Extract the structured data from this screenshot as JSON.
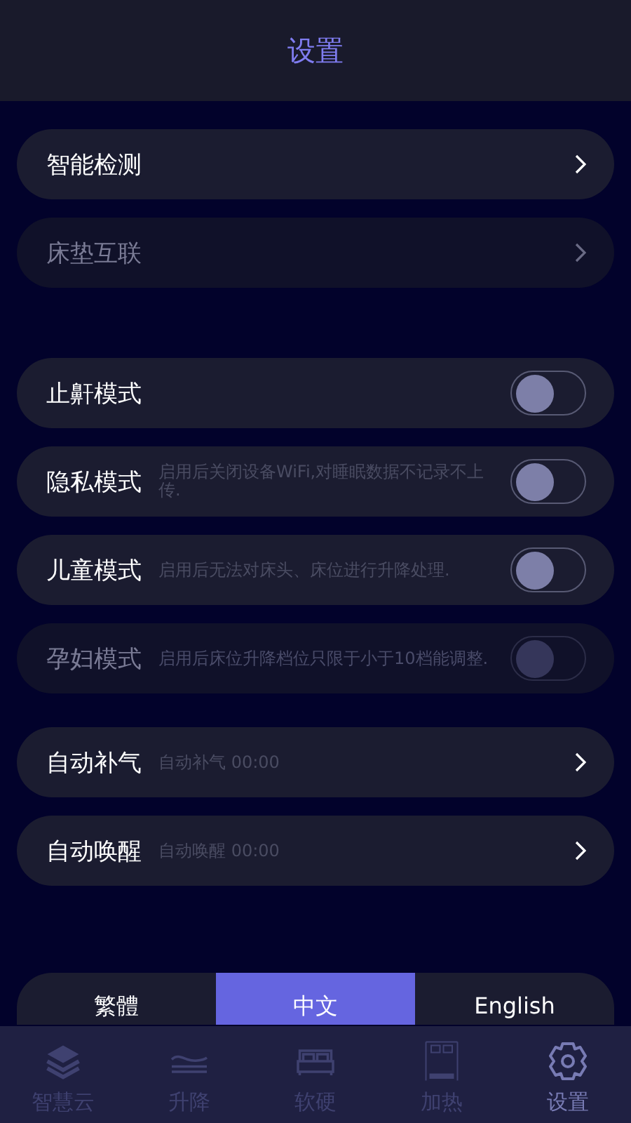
{
  "header": {
    "title": "设置"
  },
  "sections": [
    {
      "items": [
        {
          "kind": "link",
          "label": "智能检测",
          "disabled": false
        },
        {
          "kind": "link",
          "label": "床垫互联",
          "disabled": true
        }
      ]
    },
    {
      "items": [
        {
          "kind": "toggle",
          "label": "止鼾模式",
          "on": false,
          "disabled": false
        },
        {
          "kind": "toggle",
          "label": "隐私模式",
          "description": "启用后关闭设备WiFi,对睡眠数据不记录不上传.",
          "on": false,
          "disabled": false
        },
        {
          "kind": "toggle",
          "label": "儿童模式",
          "description": "启用后无法对床头、床位进行升降处理.",
          "on": false,
          "disabled": false
        },
        {
          "kind": "toggle",
          "label": "孕妇模式",
          "description": "启用后床位升降档位只限于小于10档能调整.",
          "on": false,
          "disabled": true
        }
      ]
    },
    {
      "items": [
        {
          "kind": "link",
          "label": "自动补气",
          "description": "自动补气 00:00",
          "disabled": false
        },
        {
          "kind": "link",
          "label": "自动唤醒",
          "description": "自动唤醒 00:00",
          "disabled": false
        }
      ]
    }
  ],
  "languages": [
    {
      "label": "繁體",
      "selected": false
    },
    {
      "label": "中文",
      "selected": true
    },
    {
      "label": "English",
      "selected": false
    }
  ],
  "tabs": [
    {
      "kind": "cloud",
      "label": "智慧云",
      "selected": false
    },
    {
      "kind": "lift",
      "label": "升降",
      "selected": false
    },
    {
      "kind": "bed",
      "label": "软硬",
      "selected": false
    },
    {
      "kind": "heat",
      "label": "加热",
      "selected": false
    },
    {
      "kind": "settings",
      "label": "设置",
      "selected": true
    }
  ]
}
